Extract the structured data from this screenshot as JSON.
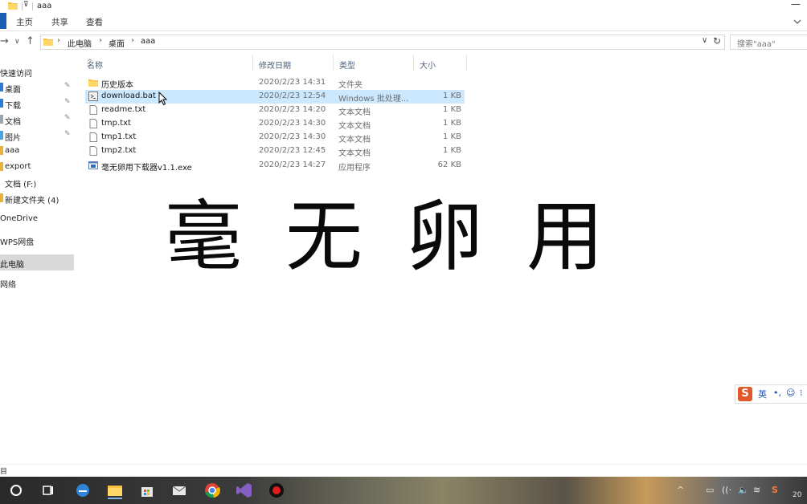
{
  "window": {
    "title": "aaa",
    "minimize_glyph": "—"
  },
  "ribbon": {
    "tabs": [
      "主页",
      "共享",
      "查看"
    ]
  },
  "address": {
    "crumbs": [
      "此电脑",
      "桌面",
      "aaa"
    ],
    "search_placeholder": "搜索\"aaa\""
  },
  "nav_pane": {
    "items": [
      {
        "label": "快速访问",
        "pinned": false
      },
      {
        "label": "桌面",
        "pinned": true
      },
      {
        "label": "下载",
        "pinned": true
      },
      {
        "label": "文档",
        "pinned": true
      },
      {
        "label": "图片",
        "pinned": true
      },
      {
        "label": "aaa",
        "pinned": false
      },
      {
        "label": "export",
        "pinned": false
      },
      {
        "label": "文档 (F:)",
        "pinned": false
      },
      {
        "label": "新建文件夹 (4)",
        "pinned": false
      },
      {
        "label": "OneDrive",
        "pinned": false
      },
      {
        "label": "WPS网盘",
        "pinned": false
      },
      {
        "label": "此电脑",
        "pinned": false
      },
      {
        "label": "网络",
        "pinned": false
      }
    ],
    "pin_glyph": "✎"
  },
  "file_list": {
    "columns": [
      "名称",
      "修改日期",
      "类型",
      "大小"
    ],
    "sort_glyph": "^",
    "rows": [
      {
        "name": "历史版本",
        "date": "2020/2/23 14:31",
        "type": "文件夹",
        "size": "",
        "icon": "folder-icon",
        "selected": false
      },
      {
        "name": "download.bat",
        "date": "2020/2/23 12:54",
        "type": "Windows 批处理...",
        "size": "1 KB",
        "icon": "batch-file-icon",
        "selected": true
      },
      {
        "name": "readme.txt",
        "date": "2020/2/23 14:20",
        "type": "文本文档",
        "size": "1 KB",
        "icon": "text-file-icon",
        "selected": false
      },
      {
        "name": "tmp.txt",
        "date": "2020/2/23 14:30",
        "type": "文本文档",
        "size": "1 KB",
        "icon": "text-file-icon",
        "selected": false
      },
      {
        "name": "tmp1.txt",
        "date": "2020/2/23 14:30",
        "type": "文本文档",
        "size": "1 KB",
        "icon": "text-file-icon",
        "selected": false
      },
      {
        "name": "tmp2.txt",
        "date": "2020/2/23 12:45",
        "type": "文本文档",
        "size": "1 KB",
        "icon": "text-file-icon",
        "selected": false
      },
      {
        "name": "毫无卵用下载器v1.1.exe",
        "date": "2020/2/23 14:27",
        "type": "应用程序",
        "size": "62 KB",
        "icon": "exe-file-icon",
        "selected": false
      }
    ]
  },
  "caption": {
    "text": "毫无卵用"
  },
  "ime_toolbar": {
    "logo": "S",
    "items": [
      "英",
      "•,",
      "☺",
      "⁝"
    ]
  },
  "status_bar": {
    "text": "目"
  },
  "taskbar": {
    "apps": [
      "cortana-icon",
      "task-view-icon",
      "edge-icon",
      "file-explorer-icon",
      "store-icon",
      "mail-icon",
      "chrome-icon",
      "visual-studio-icon",
      "recorder-icon"
    ],
    "tray": [
      "^",
      "▭",
      "((·",
      "🔈",
      "≋",
      "S",
      "20"
    ]
  },
  "colors": {
    "selection": "#cce8ff",
    "accent": "#1a5fb4",
    "sogou": "#e1582a"
  }
}
